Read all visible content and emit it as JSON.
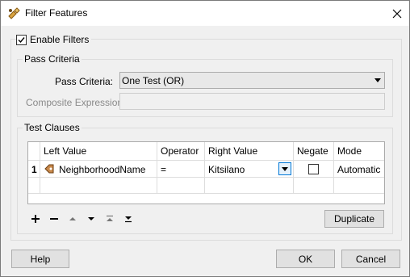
{
  "window": {
    "title": "Filter Features",
    "icon": "transformer-icon",
    "close_icon": "close-icon"
  },
  "enable_filters": {
    "label": "Enable Filters",
    "checked": true
  },
  "pass_criteria_group": {
    "title": "Pass Criteria",
    "pass_criteria_label": "Pass Criteria:",
    "pass_criteria_value": "One Test (OR)",
    "composite_expression_label": "Composite Expression:",
    "composite_expression_value": ""
  },
  "test_clauses_group": {
    "title": "Test Clauses",
    "columns": [
      "Left Value",
      "Operator",
      "Right Value",
      "Negate",
      "Mode"
    ],
    "rows": [
      {
        "number": "1",
        "left_value": "NeighborhoodName",
        "operator": "=",
        "right_value": "Kitsilano",
        "negate": false,
        "mode": "Automatic"
      }
    ],
    "toolbar": [
      "add-icon",
      "remove-icon",
      "move-up-icon",
      "move-down-icon",
      "move-top-icon",
      "move-bottom-icon"
    ],
    "duplicate_label": "Duplicate"
  },
  "footer": {
    "help_label": "Help",
    "ok_label": "OK",
    "cancel_label": "Cancel"
  },
  "colors": {
    "window_bg": "#f0f0f0",
    "titlebar_bg": "#ffffff",
    "focus_blue": "#0078d7"
  }
}
